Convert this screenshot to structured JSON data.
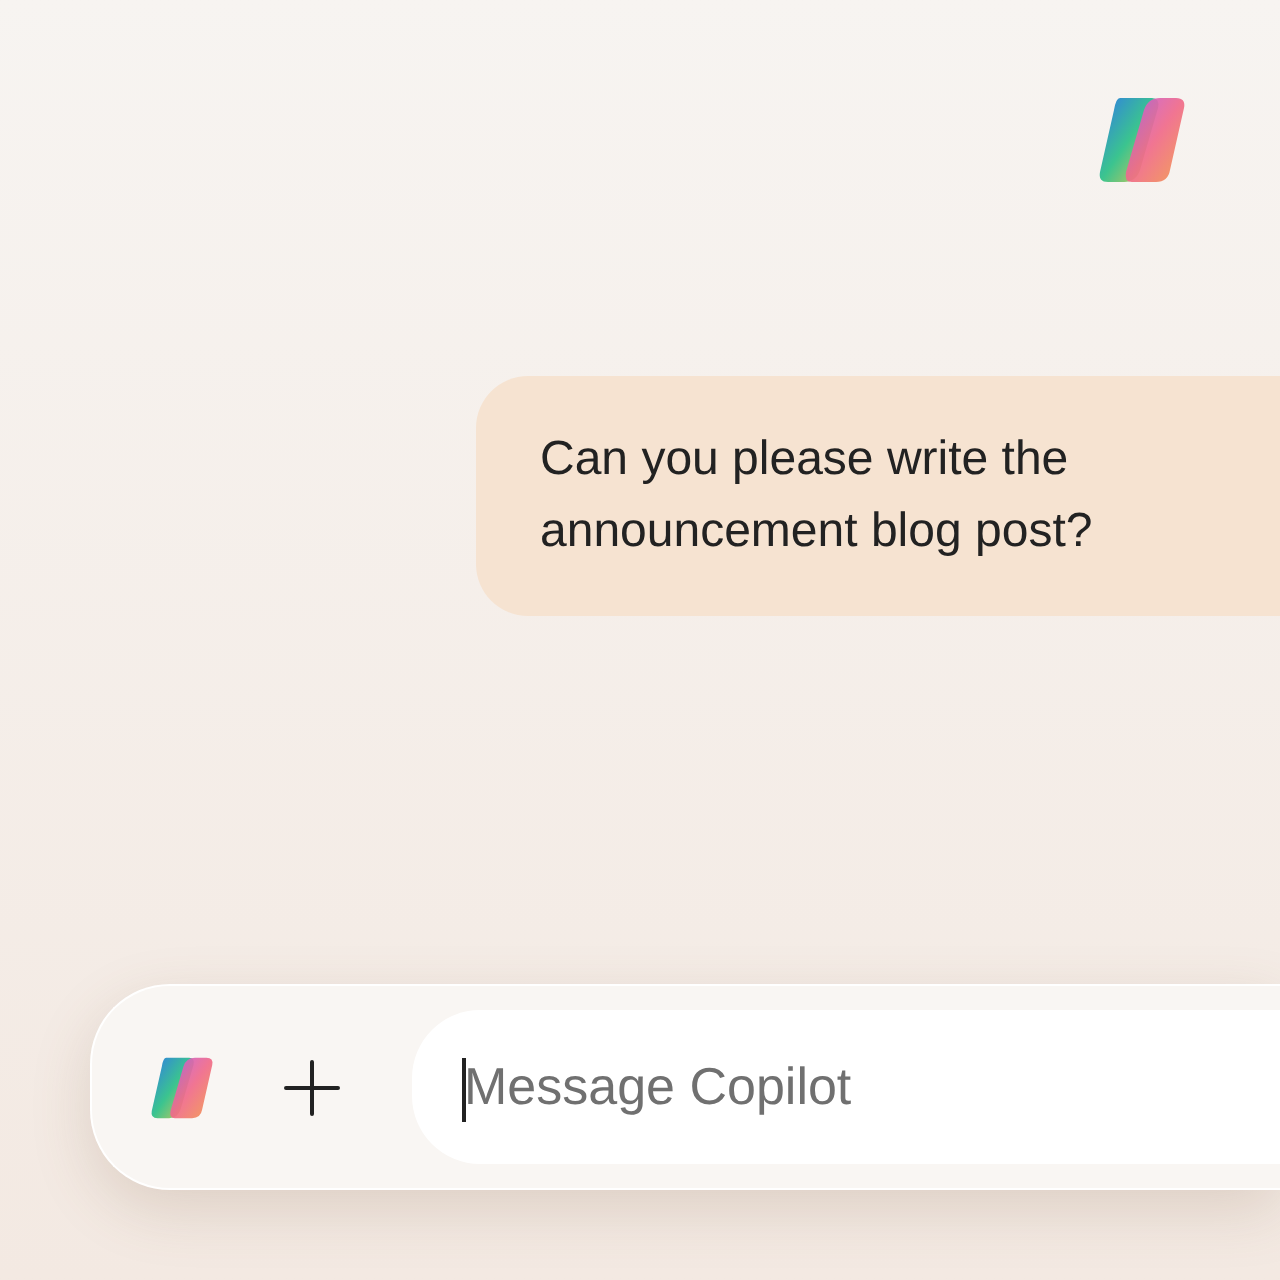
{
  "messages": [
    {
      "kind": "user",
      "text": "Can you please write the announcement blog post?"
    }
  ],
  "composer": {
    "placeholder": "Message Copilot",
    "focused": true
  }
}
